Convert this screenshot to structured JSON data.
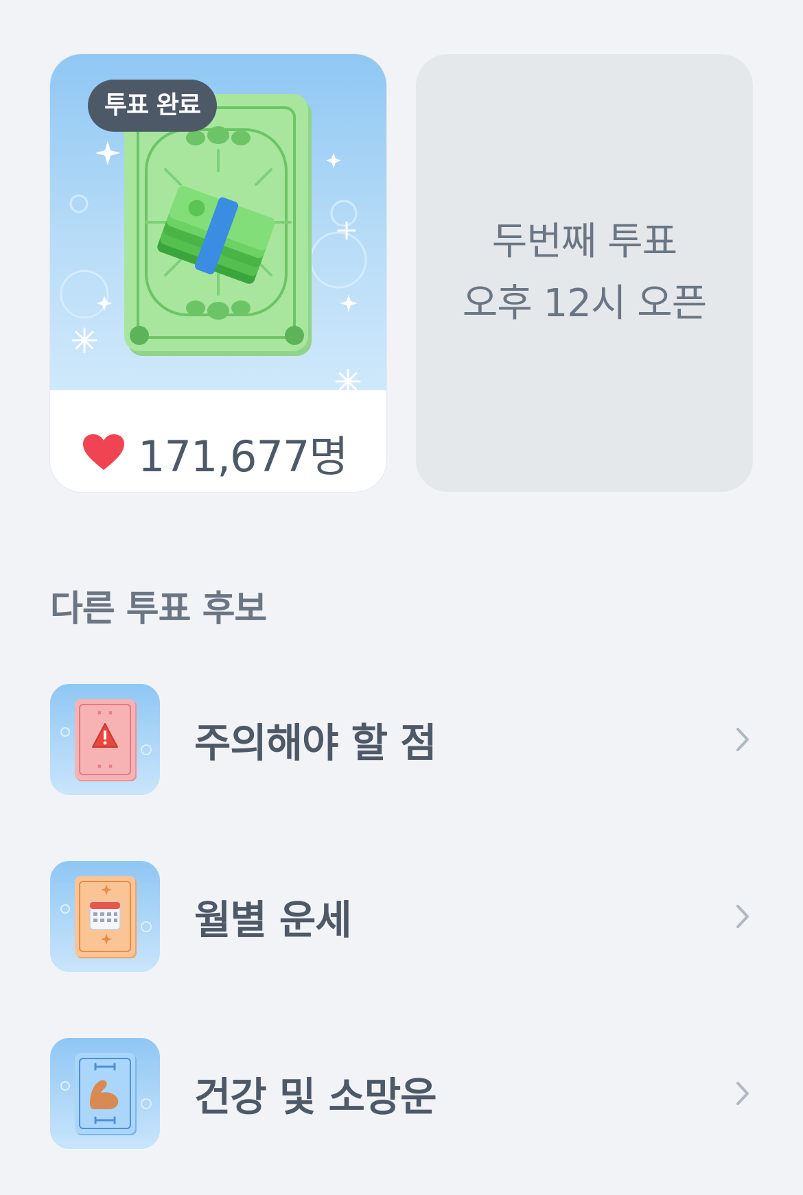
{
  "featured": {
    "badge": "투표 완료",
    "count": "171,677명",
    "heart_color": "#f04452"
  },
  "next_vote": {
    "line1": "두번째 투표",
    "line2": "오후 12시 오픈"
  },
  "section": {
    "title": "다른 투표 후보"
  },
  "candidates": [
    {
      "label": "주의해야 할 점",
      "icon": "warning-card-icon",
      "card_color": "#f7a9ad"
    },
    {
      "label": "월별 운세",
      "icon": "calendar-card-icon",
      "card_color": "#f9c08e"
    },
    {
      "label": "건강 및 소망운",
      "icon": "muscle-card-icon",
      "card_color": "#9fd0f7"
    }
  ]
}
